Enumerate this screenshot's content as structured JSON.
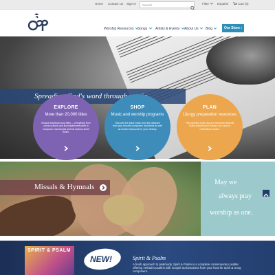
{
  "topbar": {
    "links": [
      "Home",
      "Contact Us",
      "Sign In"
    ],
    "search": {
      "value": "",
      "placeholder": "Search"
    },
    "filter_label": "Filter",
    "currency_label": "Español",
    "cart_label": "Cart (0)"
  },
  "header": {
    "nav": [
      "Worship Resources",
      "Songs",
      "Artists & Events",
      "About Us",
      "Blog"
    ],
    "store_button": "Our Store ›"
  },
  "hero": {
    "tagline": "Spreading God's word through music"
  },
  "circles": [
    {
      "title": "EXPLORE",
      "subtitle": "More than 20,000 titles",
      "description": "Browse individual song titles — everything from choral octavos and accompaniment parts to composer manuscripts and full octavos sheet music.",
      "color": "#7f63b3"
    },
    {
      "title": "SHOP",
      "subtitle": "Music and worship programs",
      "description": "Discover the latest music and new releases from your favorite composers and artists as well as trusted resources for your ministry.",
      "color": "#3d8cba"
    },
    {
      "title": "PLAN",
      "subtitle": "Liturgy preparation resources",
      "description": "Find planning tools, tips and resources that will make preparing for liturgies and special celebrations easier.",
      "color": "#eba64e"
    }
  ],
  "missals": {
    "label": "Missals & Hymnals",
    "quote_lines": [
      "May we",
      "always pray",
      "worship as one."
    ]
  },
  "promo": {
    "book_title": "SPIRIT & PSALM",
    "badge": "NEW!",
    "title": "Spirit & Psalm",
    "description": "A fresh approach to psalmody, Spirit & Psalm is a complete contemporary psalter, offering verbatim psalms with Gospel acclamations from your favorite Spirit & Song composers."
  },
  "colors": {
    "nav_text": "#2b3b5a",
    "accent": "#2e8fb8",
    "tagline_bar": "#28467a",
    "quote_panel": "#9cc9cc"
  }
}
